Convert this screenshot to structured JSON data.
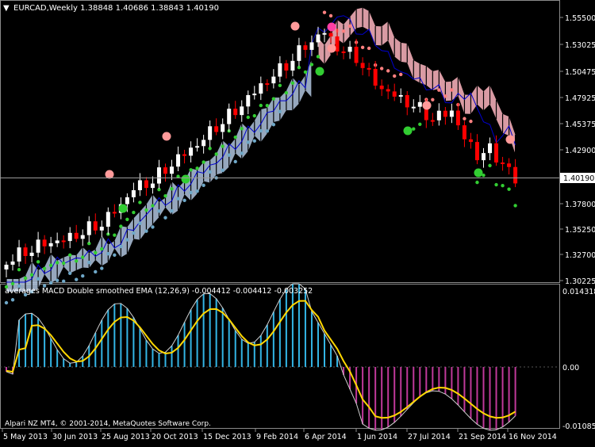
{
  "main": {
    "symbol_header": "EURCAD,Weekly  1.38848 1.40686 1.38843 1.40190",
    "current_price": "1.40190",
    "price_ticks": [
      "1.55500",
      "1.53025",
      "1.50475",
      "1.47925",
      "1.45375",
      "1.42900",
      "1.40190",
      "1.37800",
      "1.35250",
      "1.32700",
      "1.30225"
    ]
  },
  "indicator": {
    "label": "averages MACD Double smoothed EMA (12,26,9) -0.004412 -0.004412 -0.003252",
    "ticks": [
      "0.014318",
      "0.00",
      "-0.010859"
    ],
    "copyright": "Alpari NZ MT4, © 2001-2014, MetaQuotes Software Corp."
  },
  "time_axis": [
    "5 May 2013",
    "30 Jun 2013",
    "25 Aug 2013",
    "20 Oct 2013",
    "15 Dec 2013",
    "9 Feb 2014",
    "6 Apr 2014",
    "1 Jun 2014",
    "27 Jul 2014",
    "21 Sep 2014",
    "16 Nov 2014"
  ],
  "colors": {
    "background": "#000000",
    "grid": "#5a5a5a",
    "bull_candle": "#ffffff",
    "bear_candle": "#ff0000",
    "cloud_bull": "#b0c4de",
    "cloud_bear": "#ffb6c1",
    "kijun_line": "#0000cd",
    "dots_green": "#32cd32",
    "dots_pink": "#ff8080",
    "macd_positive": "#33b5e5",
    "macd_negative": "#c0399a",
    "signal_line": "#ffd700"
  }
}
